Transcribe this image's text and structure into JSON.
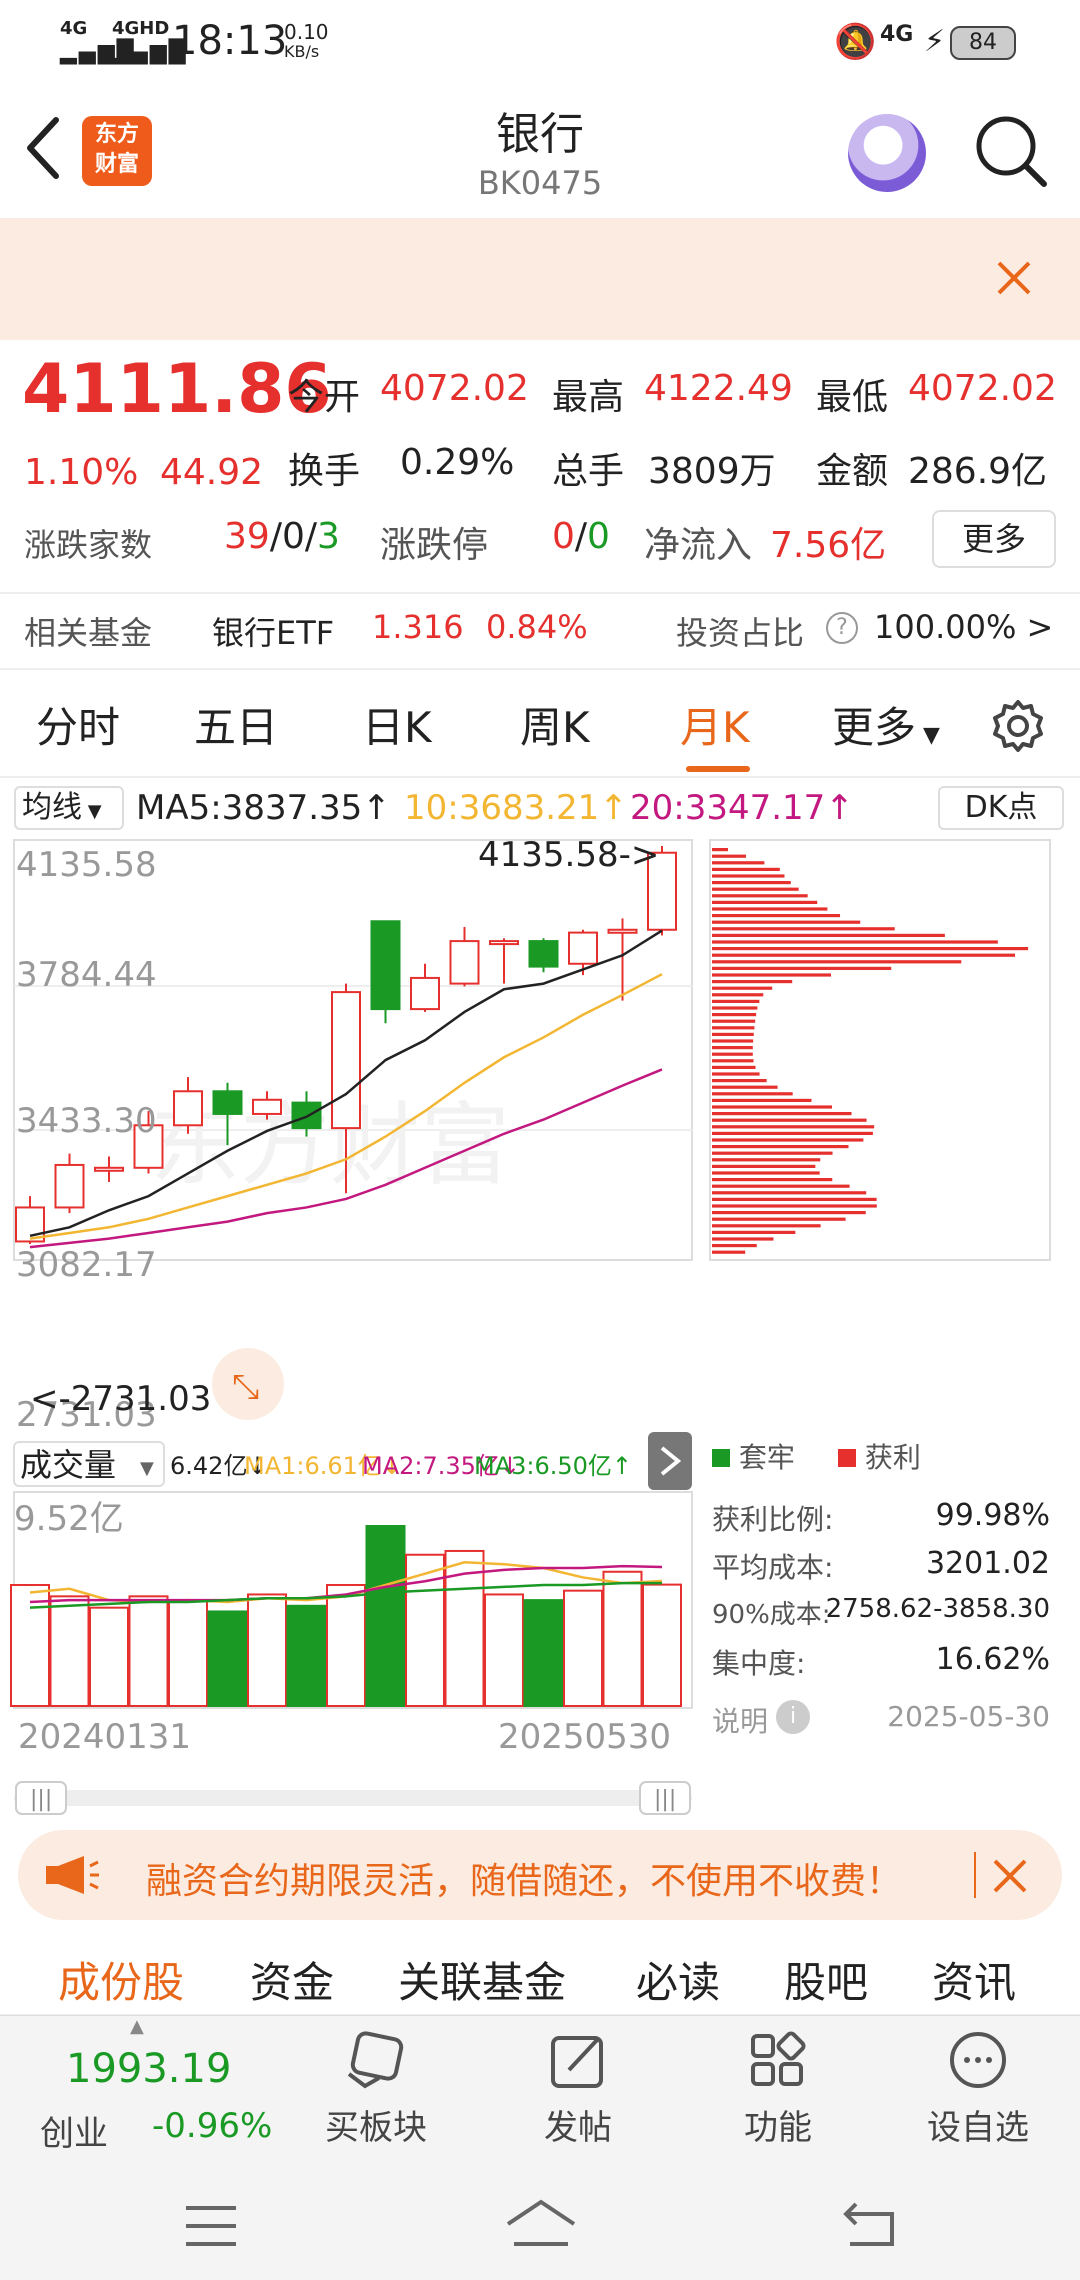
{
  "status_bar": {
    "signal1": "4G",
    "signal2": "4GHD",
    "time": "18:13",
    "speed_value": "0.10",
    "speed_unit": "KB/s",
    "right_net": "4G",
    "battery": "84"
  },
  "header": {
    "logo_line1": "东方",
    "logo_line2": "财富",
    "title": "银行",
    "code": "BK0475"
  },
  "quote": {
    "price": "4111.86",
    "change_pct": "1.10%",
    "change_abs": "44.92",
    "open_label": "今开",
    "open": "4072.02",
    "high_label": "最高",
    "high": "4122.49",
    "low_label": "最低",
    "low": "4072.02",
    "turnover_label": "换手",
    "turnover": "0.29%",
    "volume_label": "总手",
    "volume": "3809万",
    "amount_label": "金额",
    "amount": "286.9亿",
    "updown_label": "涨跌家数",
    "up": "39",
    "flat": "0",
    "down": "3",
    "limit_label": "涨跌停",
    "limit_up": "0",
    "limit_down": "0",
    "netflow_label": "净流入",
    "netflow": "7.56亿",
    "more_button": "更多",
    "fund_label": "相关基金",
    "fund_name": "银行ETF",
    "fund_price": "1.316",
    "fund_pct": "0.84%",
    "invest_label": "投资占比",
    "invest_value": "100.00% >"
  },
  "tabs": [
    "分时",
    "五日",
    "日K",
    "周K",
    "月K",
    "更多"
  ],
  "active_tab_index": 4,
  "ma_bar": {
    "selector": "均线",
    "ma5": "MA5:3837.35↑",
    "ma10": "10:3683.21↑",
    "ma20": "20:3347.17↑",
    "dk": "DK点"
  },
  "price_axis": [
    "4135.58",
    "3784.44",
    "3433.30",
    "3082.17",
    "2731.03"
  ],
  "high_marker": "4135.58->",
  "low_marker": "<-2731.03",
  "watermark": "东方财富",
  "volume_bar": {
    "selector": "成交量",
    "value": "6.42亿↓",
    "ma1": "MA1:6.61亿↓",
    "ma2": "MA2:7.35亿↓",
    "ma3": "MA3:6.50亿↑",
    "axis_top": "9.52亿",
    "date_start": "20240131",
    "date_end": "20250530"
  },
  "chip_panel": {
    "legend_trapped": "套牢",
    "legend_profit": "获利",
    "profit_ratio_label": "获利比例:",
    "profit_ratio": "99.98%",
    "avg_cost_label": "平均成本:",
    "avg_cost": "3201.02",
    "cost90_label": "90%成本:",
    "cost90": "2758.62-3858.30",
    "concentration_label": "集中度:",
    "concentration": "16.62%",
    "note_label": "说明",
    "date": "2025-05-30"
  },
  "ad": {
    "text": "融资合约期限灵活，随借随还，不使用不收费！"
  },
  "subtabs": [
    "成份股",
    "资金",
    "关联基金",
    "必读",
    "股吧",
    "资讯"
  ],
  "bottom_nav": {
    "index_value": "1993.19",
    "index_name": "创业",
    "index_change": "-0.96%",
    "items": [
      "买板块",
      "发帖",
      "功能",
      "设自选"
    ]
  },
  "colors": {
    "up": "#e5302e",
    "down": "#1a9a25",
    "accent": "#e8671a",
    "ma5": "#222222",
    "ma10": "#f2b632",
    "ma20": "#c2187f"
  },
  "chart_data": {
    "type": "candlestick",
    "period": "monthly",
    "ylim": [
      2731.03,
      4135.58
    ],
    "candles": [
      {
        "o": 2740,
        "c": 2860,
        "h": 2900,
        "l": 2731.03
      },
      {
        "o": 2860,
        "c": 3010,
        "h": 3050,
        "l": 2840
      },
      {
        "o": 2990,
        "c": 3000,
        "h": 3040,
        "l": 2950
      },
      {
        "o": 3000,
        "c": 3150,
        "h": 3200,
        "l": 2980
      },
      {
        "o": 3150,
        "c": 3270,
        "h": 3320,
        "l": 3120
      },
      {
        "o": 3270,
        "c": 3190,
        "h": 3300,
        "l": 3080
      },
      {
        "o": 3190,
        "c": 3240,
        "h": 3270,
        "l": 3170
      },
      {
        "o": 3230,
        "c": 3140,
        "h": 3270,
        "l": 3110
      },
      {
        "o": 3140,
        "c": 3620,
        "h": 3650,
        "l": 2910
      },
      {
        "o": 3870,
        "c": 3560,
        "h": 3870,
        "l": 3510
      },
      {
        "o": 3560,
        "c": 3670,
        "h": 3720,
        "l": 3550
      },
      {
        "o": 3650,
        "c": 3800,
        "h": 3850,
        "l": 3640
      },
      {
        "o": 3800,
        "c": 3800,
        "h": 3810,
        "l": 3650
      },
      {
        "o": 3800,
        "c": 3710,
        "h": 3810,
        "l": 3690
      },
      {
        "o": 3720,
        "c": 3830,
        "h": 3840,
        "l": 3680
      },
      {
        "o": 3830,
        "c": 3840,
        "h": 3880,
        "l": 3590
      },
      {
        "o": 3840,
        "c": 4111.86,
        "h": 4135.58,
        "l": 3820
      }
    ],
    "ma5": [
      2760,
      2790,
      2850,
      2900,
      2980,
      3060,
      3130,
      3180,
      3260,
      3380,
      3450,
      3550,
      3630,
      3650,
      3700,
      3750,
      3837.35
    ],
    "ma10": [
      2750,
      2770,
      2790,
      2820,
      2860,
      2900,
      2940,
      2980,
      3030,
      3110,
      3200,
      3300,
      3390,
      3460,
      3540,
      3610,
      3683.21
    ],
    "ma20": [
      2720,
      2735,
      2750,
      2770,
      2790,
      2810,
      2840,
      2860,
      2890,
      2940,
      3000,
      3060,
      3120,
      3170,
      3230,
      3290,
      3347.17
    ],
    "volumes": [
      6.4,
      5.8,
      5.2,
      5.8,
      5.6,
      5.0,
      5.9,
      5.3,
      6.4,
      9.52,
      8.0,
      8.2,
      5.9,
      5.6,
      6.1,
      7.1,
      6.42
    ],
    "vol_ma1": [
      6.0,
      6.2,
      5.6,
      5.5,
      5.6,
      5.5,
      5.7,
      5.6,
      5.8,
      6.4,
      7.0,
      7.6,
      7.5,
      7.3,
      6.8,
      6.5,
      6.61
    ],
    "vol_ma2": [
      5.5,
      5.6,
      5.6,
      5.6,
      5.6,
      5.6,
      5.7,
      5.7,
      5.9,
      6.3,
      6.6,
      7.0,
      7.2,
      7.3,
      7.3,
      7.4,
      7.35
    ],
    "vol_ma3": [
      5.2,
      5.3,
      5.4,
      5.5,
      5.5,
      5.6,
      5.7,
      5.7,
      5.8,
      6.0,
      6.1,
      6.2,
      6.3,
      6.4,
      6.4,
      6.5,
      6.5
    ]
  }
}
